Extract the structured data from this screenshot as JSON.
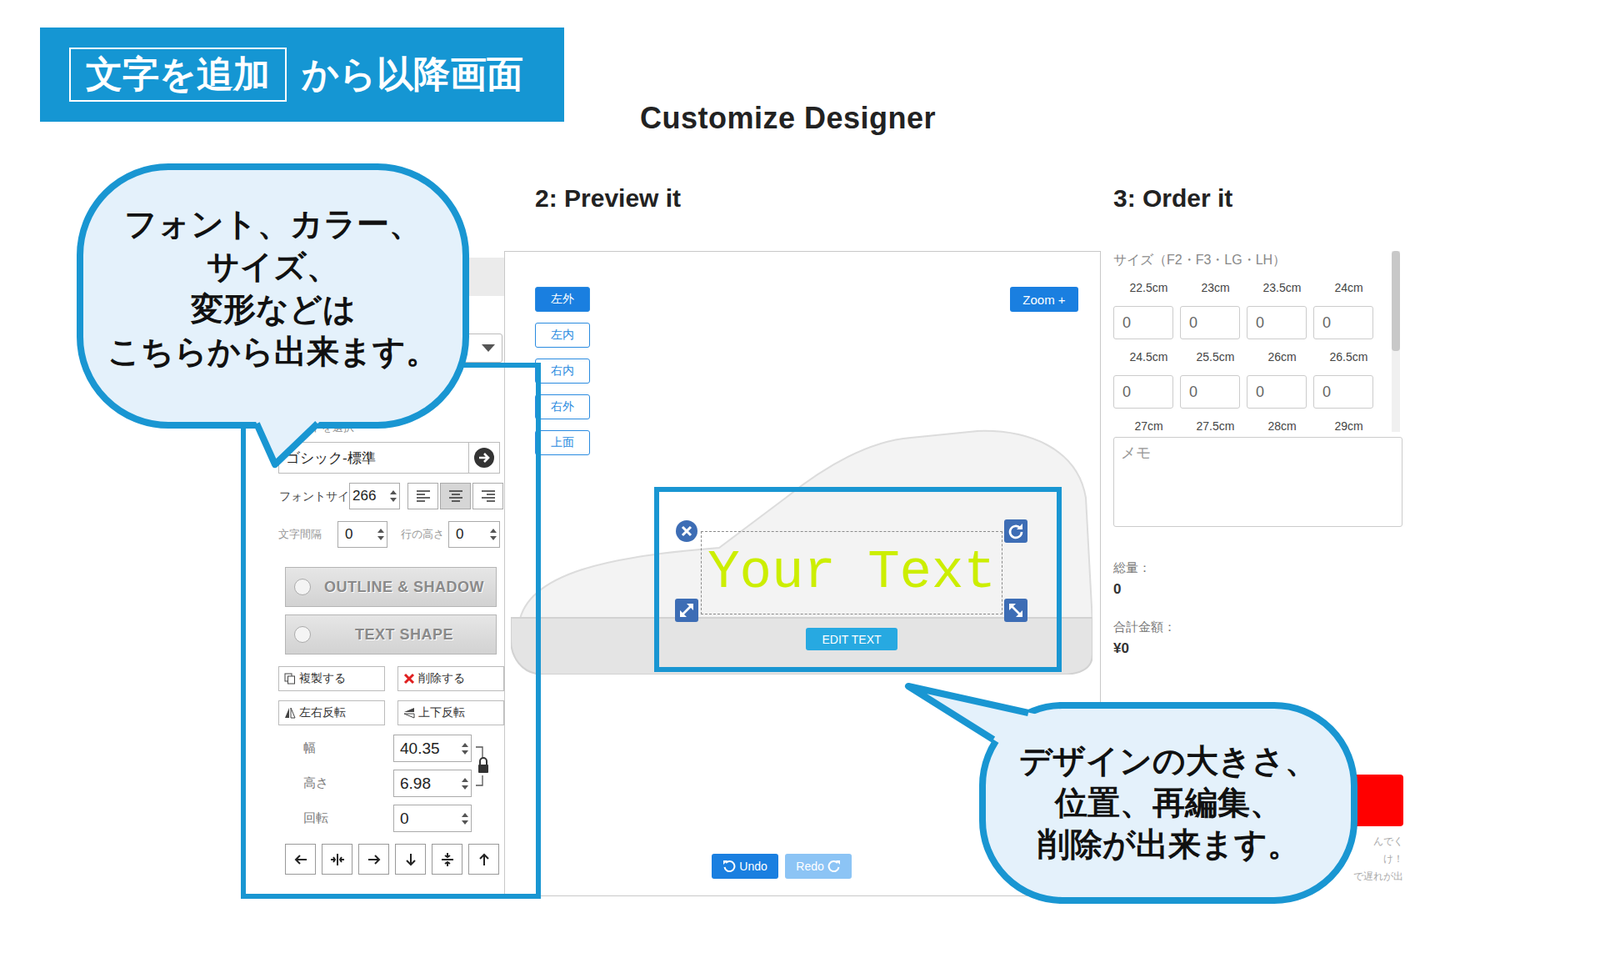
{
  "banner": {
    "boxed": "文字を追加",
    "rest": "から以降画面"
  },
  "title": "Customize Designer",
  "controls": {
    "font_label": "フォントを選択",
    "font": "ゴシック-標準",
    "size_label": "フォントサイ",
    "size": "266",
    "align": [
      {
        "kind": "left",
        "selected": false
      },
      {
        "kind": "center",
        "selected": true
      },
      {
        "kind": "right",
        "selected": false
      }
    ],
    "spacing_label": "文字間隔",
    "spacing": "0",
    "line_label": "行の高さ",
    "line": "0",
    "toggles": [
      {
        "label": "OUTLINE & SHADOW",
        "on": false
      },
      {
        "label": "TEXT SHAPE",
        "on": false
      }
    ],
    "actions": [
      {
        "label": "複製する",
        "kind": "copy"
      },
      {
        "label": "削除する",
        "kind": "delete"
      },
      {
        "label": "左右反転",
        "kind": "flip-h"
      },
      {
        "label": "上下反転",
        "kind": "flip-v"
      }
    ],
    "dims": [
      {
        "label": "幅",
        "value": "40.35"
      },
      {
        "label": "高さ",
        "value": "6.98"
      },
      {
        "label": "回転",
        "value": "0"
      }
    ],
    "ratio_locked": true,
    "nudges": [
      {
        "kind": "left"
      },
      {
        "kind": "center-h"
      },
      {
        "kind": "right"
      },
      {
        "kind": "down"
      },
      {
        "kind": "center-v"
      },
      {
        "kind": "up"
      }
    ]
  },
  "preview": {
    "heading": "2: Preview it",
    "views": [
      {
        "label": "左外",
        "selected": true
      },
      {
        "label": "左内",
        "selected": false
      },
      {
        "label": "右内",
        "selected": false
      },
      {
        "label": "右外",
        "selected": false
      },
      {
        "label": "上面",
        "selected": false
      }
    ],
    "zoom": "Zoom +",
    "text_object": {
      "text": "Your Text",
      "color": "#ccee00",
      "edit": "EDIT TEXT"
    },
    "undo": {
      "label": "Undo",
      "disabled": false
    },
    "redo": {
      "label": "Redo",
      "disabled": true
    }
  },
  "order": {
    "heading": "3: Order it",
    "size_title": "サイズ（F2・F3・LG・LH）",
    "sizes": [
      {
        "label": "22.5cm",
        "qty": "0"
      },
      {
        "label": "23cm",
        "qty": "0"
      },
      {
        "label": "23.5cm",
        "qty": "0"
      },
      {
        "label": "24cm",
        "qty": "0"
      },
      {
        "label": "24.5cm",
        "qty": "0"
      },
      {
        "label": "25.5cm",
        "qty": "0"
      },
      {
        "label": "26cm",
        "qty": "0"
      },
      {
        "label": "26.5cm",
        "qty": "0"
      }
    ],
    "sizes_partial": [
      "27cm",
      "27.5cm",
      "28cm",
      "29cm"
    ],
    "memo_placeholder": "メモ",
    "total_label": "総量：",
    "total": "0",
    "amount_label": "合計金額：",
    "amount": "¥0",
    "notes": [
      "んでく",
      "け！",
      "で遅れが出"
    ]
  },
  "callouts": [
    {
      "lines": [
        "フォント、カラー、",
        "サイズ、",
        "変形などは",
        "こちらから出来ます。"
      ]
    },
    {
      "lines": [
        "デザインの大きさ、",
        "位置、再編集、",
        "削除が出来ます。"
      ]
    }
  ]
}
